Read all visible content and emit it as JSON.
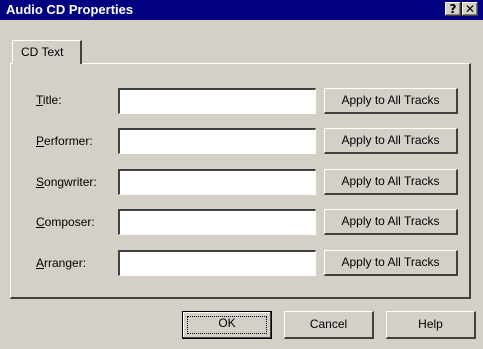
{
  "window": {
    "title": "Audio CD Properties",
    "help_glyph": "?",
    "close_glyph": "✕"
  },
  "tabs": [
    {
      "label": "CD Text"
    }
  ],
  "fields": [
    {
      "mnemonic": "T",
      "rest": "itle:",
      "value": "",
      "button_label": "Apply to All Tracks"
    },
    {
      "mnemonic": "P",
      "rest": "erformer:",
      "value": "",
      "button_label": "Apply to All Tracks"
    },
    {
      "mnemonic": "S",
      "rest": "ongwriter:",
      "value": "",
      "button_label": "Apply to All Tracks"
    },
    {
      "mnemonic": "C",
      "rest": "omposer:",
      "value": "",
      "button_label": "Apply to All Tracks"
    },
    {
      "mnemonic": "A",
      "rest": "rranger:",
      "value": "",
      "button_label": "Apply to All Tracks"
    }
  ],
  "footer": {
    "ok_label": "OK",
    "cancel_label": "Cancel",
    "help_label": "Help"
  },
  "colors": {
    "title_bar": "#000080",
    "face": "#d4d0c8"
  }
}
